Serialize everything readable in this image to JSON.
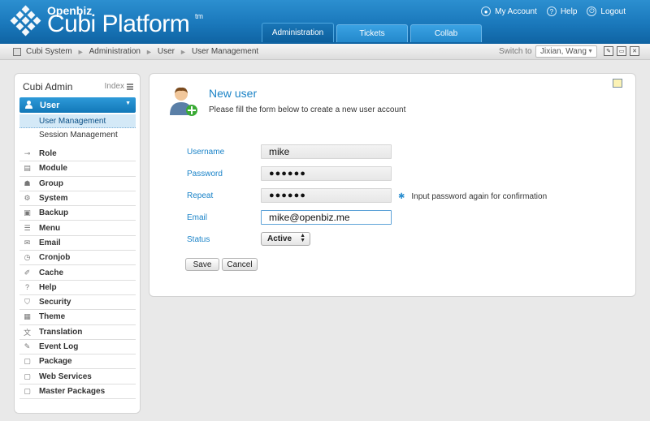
{
  "header": {
    "brand_small": "Openbiz",
    "brand_big": "Cubi Platform",
    "brand_tm": "tm",
    "links": [
      {
        "label": "My Account",
        "icon": "person-icon"
      },
      {
        "label": "Help",
        "icon": "help-icon"
      },
      {
        "label": "Logout",
        "icon": "logout-icon"
      }
    ],
    "tabs": [
      {
        "label": "Administration",
        "active": true
      },
      {
        "label": "Tickets",
        "active": false
      },
      {
        "label": "Collab",
        "active": false
      }
    ]
  },
  "breadcrumb": {
    "items": [
      "Cubi System",
      "Administration",
      "User",
      "User Management"
    ],
    "separator": "►",
    "switch_label": "Switch to",
    "switch_value": "Jixian, Wang"
  },
  "sidebar": {
    "title": "Cubi Admin",
    "index_label": "Index",
    "active_group": "User",
    "sub_items": [
      {
        "label": "User Management",
        "active": true
      },
      {
        "label": "Session Management",
        "active": false
      }
    ],
    "items": [
      {
        "label": "Role",
        "icon": "key-icon"
      },
      {
        "label": "Module",
        "icon": "module-icon"
      },
      {
        "label": "Group",
        "icon": "group-icon"
      },
      {
        "label": "System",
        "icon": "gear-icon"
      },
      {
        "label": "Backup",
        "icon": "backup-icon"
      },
      {
        "label": "Menu",
        "icon": "menu-icon"
      },
      {
        "label": "Email",
        "icon": "email-icon"
      },
      {
        "label": "Cronjob",
        "icon": "clock-icon"
      },
      {
        "label": "Cache",
        "icon": "cache-icon"
      },
      {
        "label": "Help",
        "icon": "help-icon"
      },
      {
        "label": "Security",
        "icon": "shield-icon"
      },
      {
        "label": "Theme",
        "icon": "theme-icon"
      },
      {
        "label": "Translation",
        "icon": "translation-icon"
      },
      {
        "label": "Event Log",
        "icon": "log-icon"
      },
      {
        "label": "Package",
        "icon": "package-icon"
      },
      {
        "label": "Web Services",
        "icon": "webservice-icon"
      },
      {
        "label": "Master Packages",
        "icon": "master-package-icon"
      }
    ]
  },
  "form": {
    "title": "New user",
    "description": "Please fill the form below to create a new user account",
    "fields": {
      "username": {
        "label": "Username",
        "value": "mike"
      },
      "password": {
        "label": "Password",
        "value": "●●●●●●"
      },
      "repeat": {
        "label": "Repeat",
        "value": "●●●●●●"
      },
      "email": {
        "label": "Email",
        "value": "mike@openbiz.me"
      },
      "status": {
        "label": "Status",
        "value": "Active"
      }
    },
    "repeat_hint": "Input password again for confirmation",
    "save_label": "Save",
    "cancel_label": "Cancel"
  },
  "colors": {
    "header_blue": "#1a78bb",
    "label_blue": "#1a83c8",
    "active_menu": "#1278b8"
  }
}
